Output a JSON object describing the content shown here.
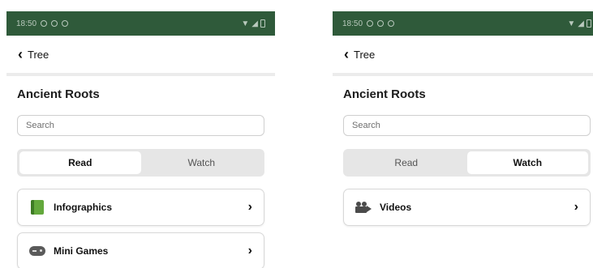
{
  "screens": [
    {
      "status": {
        "time": "18:50",
        "icons": [
          "whatsapp-icon",
          "block-icon",
          "download-icon"
        ]
      },
      "nav": {
        "back_label": "Tree"
      },
      "title": "Ancient Roots",
      "search": {
        "placeholder": "Search"
      },
      "tabs": [
        {
          "label": "Read",
          "active": true
        },
        {
          "label": "Watch",
          "active": false
        }
      ],
      "items": [
        {
          "label": "Infographics",
          "icon": "book-icon"
        },
        {
          "label": "Mini Games",
          "icon": "gamepad-icon"
        }
      ]
    },
    {
      "status": {
        "time": "18:50",
        "icons": [
          "whatsapp-icon",
          "block-icon",
          "download-icon"
        ]
      },
      "nav": {
        "back_label": "Tree"
      },
      "title": "Ancient Roots",
      "search": {
        "placeholder": "Search"
      },
      "tabs": [
        {
          "label": "Read",
          "active": false
        },
        {
          "label": "Watch",
          "active": true
        }
      ],
      "items": [
        {
          "label": "Videos",
          "icon": "movie-camera-icon"
        }
      ]
    }
  ],
  "colors": {
    "status_bar": "#2f5a3a",
    "segment_bg": "#e6e6e6",
    "active_segment": "#ffffff"
  }
}
